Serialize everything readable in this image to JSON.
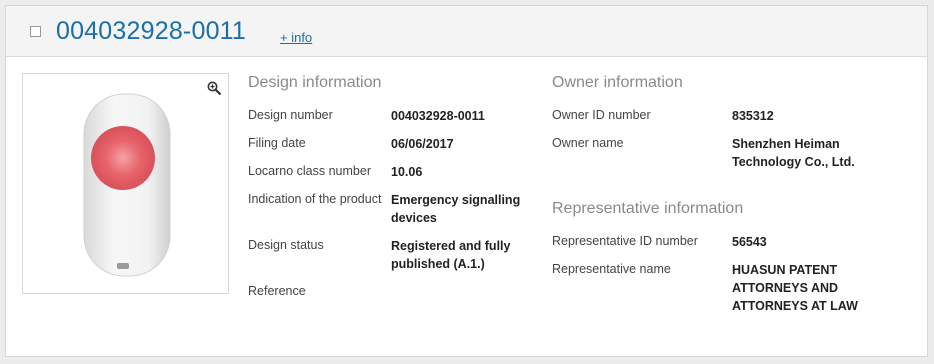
{
  "header": {
    "title": "004032928-0011",
    "info_link": "+ info"
  },
  "image": {
    "zoom_icon": "zoom-in-icon"
  },
  "design": {
    "section_title": "Design information",
    "rows": [
      {
        "label": "Design number",
        "value": "004032928-0011"
      },
      {
        "label": "Filing date",
        "value": "06/06/2017"
      },
      {
        "label": "Locarno class number",
        "value": "10.06"
      },
      {
        "label": "Indication of the product",
        "value_lines": [
          "Emergency signalling",
          "devices"
        ]
      },
      {
        "label": "Design status",
        "value_lines": [
          "Registered and fully",
          "published (A.1.)"
        ]
      },
      {
        "label": "Reference",
        "value": ""
      }
    ]
  },
  "owner": {
    "section_title": "Owner information",
    "rows": [
      {
        "label": "Owner ID number",
        "value": "835312"
      },
      {
        "label": "Owner name",
        "value_lines": [
          "Shenzhen Heiman",
          "Technology Co., Ltd."
        ]
      }
    ]
  },
  "representative": {
    "section_title": "Representative information",
    "rows": [
      {
        "label": "Representative ID number",
        "value": "56543"
      },
      {
        "label": "Representative name",
        "value_lines": [
          "HUASUN PATENT",
          "ATTORNEYS AND",
          "ATTORNEYS AT LAW"
        ]
      }
    ]
  },
  "colors": {
    "accent": "#1a6fa6",
    "button_red": "#e8636b"
  }
}
